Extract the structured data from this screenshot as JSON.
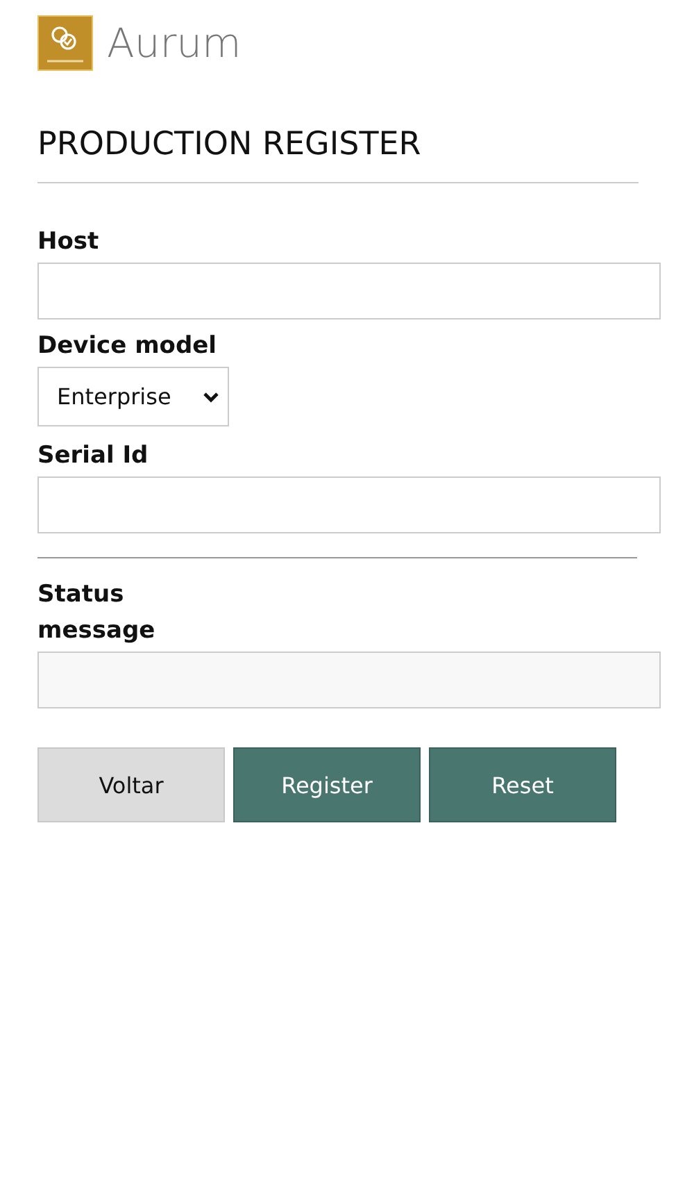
{
  "logo": {
    "text": "Aurum"
  },
  "title": "PRODUCTION REGISTER",
  "fields": [
    {
      "kind": "input",
      "label": "Host"
    },
    {
      "kind": "select",
      "label": "Device model",
      "value": "Enterprise"
    },
    {
      "kind": "input",
      "label": "Serial Id"
    },
    {
      "kind": "divider"
    },
    {
      "kind": "readonly",
      "label": "Status message"
    }
  ],
  "buttons": [
    {
      "kind": "secondary",
      "label": "Voltar"
    },
    {
      "kind": "primary",
      "label": "Register"
    },
    {
      "kind": "primary",
      "label": "Reset"
    }
  ]
}
